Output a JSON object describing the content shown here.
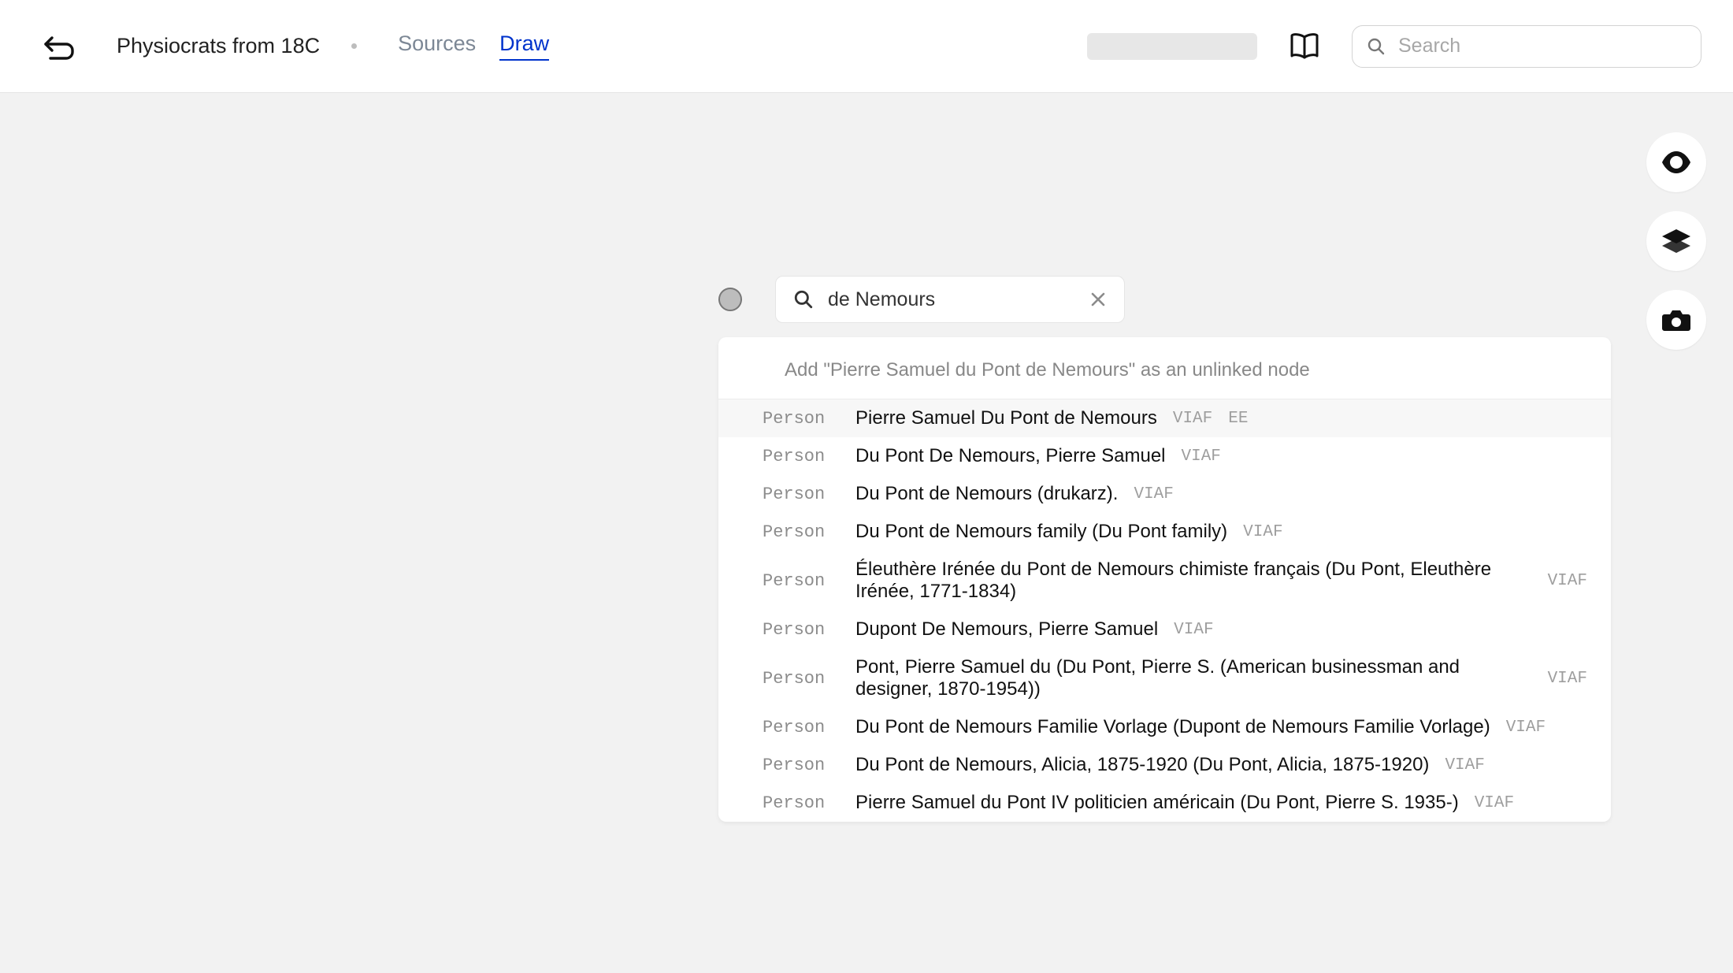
{
  "header": {
    "title": "Physiocrats from 18C",
    "tabs": {
      "sources": "Sources",
      "draw": "Draw"
    },
    "search_placeholder": "Search"
  },
  "node_search": {
    "value": "de Nemours"
  },
  "add_text": "Add \"Pierre Samuel du Pont de Nemours\" as an unlinked node",
  "results": [
    {
      "type": "Person",
      "name": "Pierre Samuel Du Pont de Nemours",
      "tags": [
        "VIAF",
        "EE"
      ],
      "selected": true
    },
    {
      "type": "Person",
      "name": "Du Pont De Nemours, Pierre Samuel",
      "tags": [
        "VIAF"
      ]
    },
    {
      "type": "Person",
      "name": "Du Pont de Nemours (drukarz).",
      "tags": [
        "VIAF"
      ]
    },
    {
      "type": "Person",
      "name": "Du Pont de Nemours family (Du Pont family)",
      "tags": [
        "VIAF"
      ]
    },
    {
      "type": "Person",
      "name": "Éleuthère Irénée du Pont de Nemours chimiste français (Du Pont, Eleuthère Irénée, 1771-1834)",
      "tags": [
        "VIAF"
      ]
    },
    {
      "type": "Person",
      "name": "Dupont De Nemours, Pierre Samuel",
      "tags": [
        "VIAF"
      ]
    },
    {
      "type": "Person",
      "name": "Pont, Pierre Samuel du (Du Pont, Pierre S. (American businessman and designer, 1870-1954))",
      "tags": [
        "VIAF"
      ]
    },
    {
      "type": "Person",
      "name": "Du Pont de Nemours Familie Vorlage (Dupont de Nemours Familie Vorlage)",
      "tags": [
        "VIAF"
      ]
    },
    {
      "type": "Person",
      "name": "Du Pont de Nemours, Alicia, 1875-1920 (Du Pont, Alicia, 1875-1920)",
      "tags": [
        "VIAF"
      ]
    },
    {
      "type": "Person",
      "name": "Pierre Samuel du Pont IV politicien américain (Du Pont, Pierre S. 1935-)",
      "tags": [
        "VIAF"
      ]
    }
  ]
}
